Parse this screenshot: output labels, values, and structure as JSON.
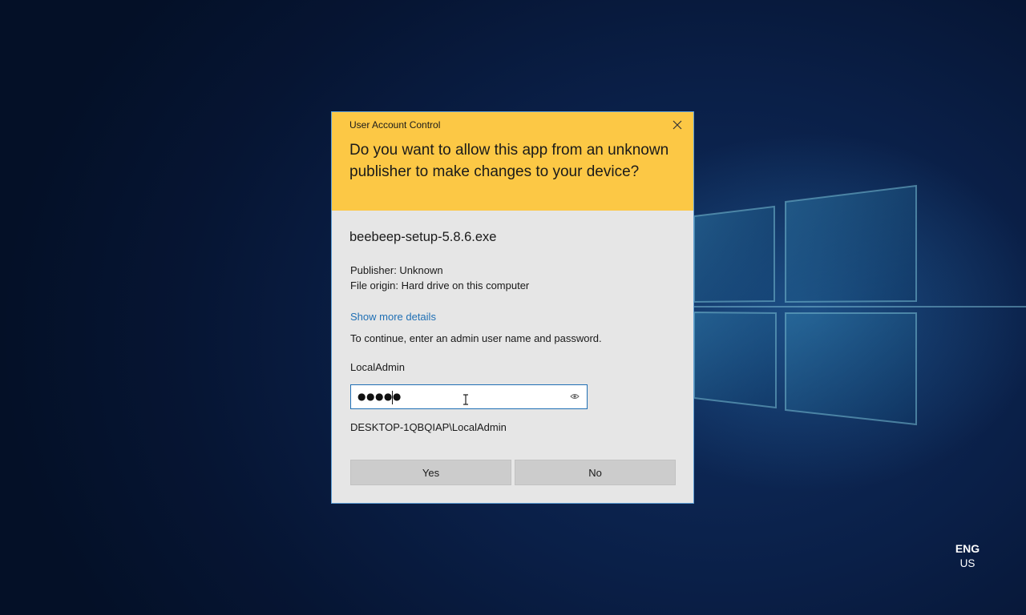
{
  "uac": {
    "title": "User Account Control",
    "question": "Do you want to allow this app from an unknown publisher to make changes to your device?",
    "app_name": "beebeep-setup-5.8.6.exe",
    "publisher": "Publisher: Unknown",
    "file_origin": "File origin: Hard drive on this computer",
    "details_link": "Show more details",
    "instruction": "To continue, enter an admin user name and password.",
    "username": "LocalAdmin",
    "password_masked": "●●●●●",
    "account": "DESKTOP-1QBQIAP\\LocalAdmin",
    "yes_label": "Yes",
    "no_label": "No"
  },
  "language": {
    "code": "ENG",
    "region": "US"
  },
  "icons": {
    "close": "close-icon",
    "reveal": "eye-icon",
    "cursor": "text-cursor-icon"
  },
  "colors": {
    "header": "#fcc845",
    "body": "#e6e6e6",
    "link": "#1f6fb4",
    "desktop": "#0a1f47"
  }
}
